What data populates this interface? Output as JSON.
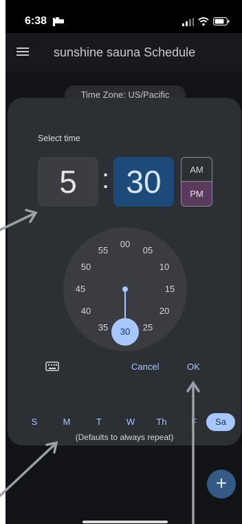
{
  "status_bar": {
    "time": "6:38",
    "icons": [
      "bed-icon",
      "signal-icon",
      "wifi-icon",
      "battery-icon"
    ]
  },
  "app_bar": {
    "title": "sunshine sauna Schedule",
    "menu_icon": "menu-icon"
  },
  "timezone": {
    "label": "Time Zone: US/Pacific"
  },
  "time_picker": {
    "label": "Select time",
    "hour": "5",
    "separator": ":",
    "minute": "30",
    "am_label": "AM",
    "pm_label": "PM",
    "selected_period": "PM",
    "dial_numbers": [
      "00",
      "05",
      "10",
      "15",
      "20",
      "25",
      "30",
      "35",
      "40",
      "45",
      "50",
      "55"
    ],
    "selected_minute": "30",
    "keyboard_icon": "keyboard-icon",
    "cancel_label": "Cancel",
    "ok_label": "OK"
  },
  "days": {
    "items": [
      {
        "label": "S",
        "selected": false
      },
      {
        "label": "M",
        "selected": false
      },
      {
        "label": "T",
        "selected": false
      },
      {
        "label": "W",
        "selected": false
      },
      {
        "label": "Th",
        "selected": false
      },
      {
        "label": "F",
        "selected": false
      },
      {
        "label": "Sa",
        "selected": true
      }
    ],
    "note": "(Defaults to always repeat)"
  },
  "fab": {
    "label": "+",
    "icon": "plus-icon"
  },
  "colors": {
    "background": "#121316",
    "dialog": "#2c2f33",
    "accent": "#a9c7ff",
    "minute_box": "#1d4a78",
    "pm_selected": "#5a3b5e",
    "fab": "#355a86",
    "annotation_arrow": "#9aa0a6"
  }
}
